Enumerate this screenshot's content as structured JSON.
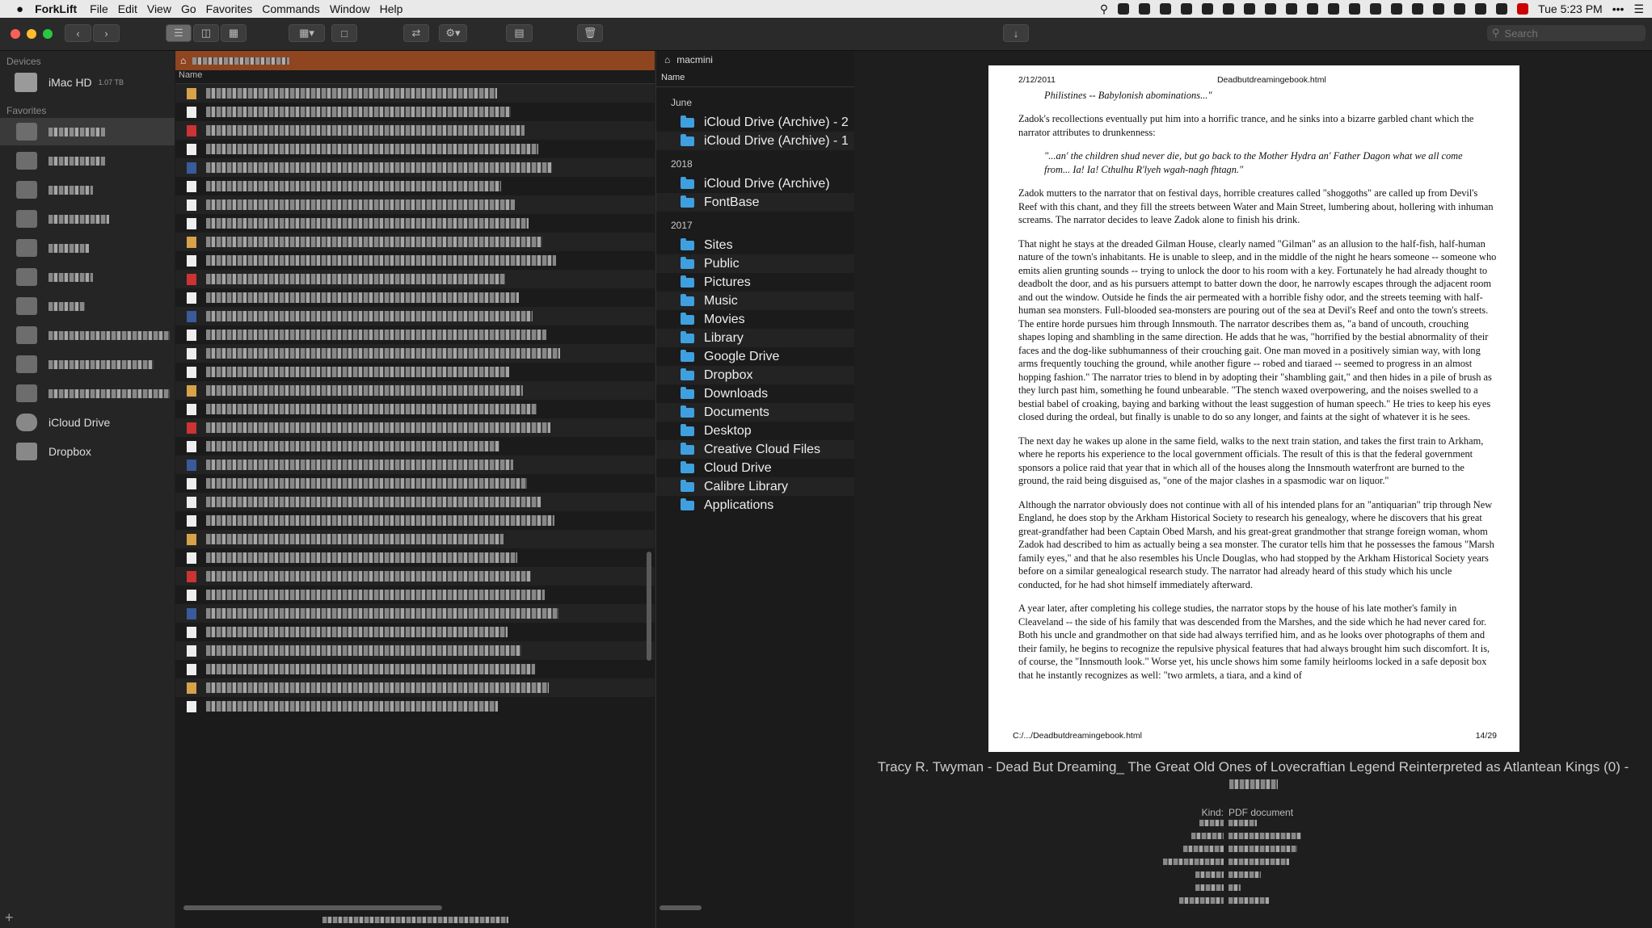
{
  "menubar": {
    "apple": "",
    "app_name": "ForkLift",
    "items": [
      "File",
      "Edit",
      "View",
      "Go",
      "Favorites",
      "Commands",
      "Window",
      "Help"
    ],
    "clock": "Tue 5:23 PM"
  },
  "toolbar": {
    "back_icon": "chevron-left-icon",
    "forward_icon": "chevron-right-icon",
    "search_placeholder": "Search"
  },
  "sidebar": {
    "devices_header": "Devices",
    "device_name": "iMac HD",
    "device_size": "1.07 TB",
    "favorites_header": "Favorites",
    "icloud_label": "iCloud Drive",
    "dropbox_label": "Dropbox"
  },
  "pane1": {
    "col_name": "Name",
    "row_count": 34
  },
  "pane2": {
    "location": "macmini",
    "col_name": "Name",
    "groups": [
      {
        "label": "June",
        "items": [
          "iCloud Drive (Archive) - 2",
          "iCloud Drive (Archive) - 1"
        ]
      },
      {
        "label": "2018",
        "items": [
          "iCloud Drive (Archive)",
          "FontBase"
        ]
      },
      {
        "label": "2017",
        "items": [
          "Sites",
          "Public",
          "Pictures",
          "Music",
          "Movies",
          "Library",
          "Google Drive",
          "Dropbox",
          "Downloads",
          "Documents",
          "Desktop",
          "Creative Cloud Files",
          "Cloud Drive",
          "Calibre Library",
          "Applications"
        ]
      }
    ]
  },
  "preview": {
    "page_date": "2/12/2011",
    "page_file": "Deadbutdreamingebook.html",
    "line0": "Philistines -- Babylonish abominations...\"",
    "p1": "Zadok's recollections eventually put him into a horrific trance, and he sinks into a bizarre garbled chant which the narrator attributes to drunkenness:",
    "q1": "\"...an' the children shud never die, but go back to the Mother Hydra an' Father Dagon what we all come from... Ia! Ia! Cthulhu R'lyeh wgah-nagh fhtagn.\"",
    "p2": "Zadok mutters to the narrator that on festival days, horrible creatures called \"shoggoths\" are called up from Devil's Reef with this chant, and they fill the streets between Water and Main Street, lumbering about, hollering with inhuman screams. The narrator decides to leave Zadok alone to finish his drink.",
    "p3": "That night he stays at the dreaded Gilman House, clearly named \"Gilman\" as an allusion to the half-fish, half-human nature of the town's inhabitants. He is unable to sleep, and in the middle of the night he hears someone -- someone who emits alien grunting sounds -- trying to unlock the door to his room with a key. Fortunately he had already thought to deadbolt the door, and as his pursuers attempt to batter down the door, he narrowly escapes through the adjacent room and out the window. Outside he finds the air permeated with a horrible fishy odor, and the streets teeming with half-human sea monsters. Full-blooded sea-monsters are pouring out of the sea at Devil's Reef and onto the town's streets. The entire horde pursues him through Innsmouth. The narrator describes them as, \"a band of uncouth, crouching shapes loping and shambling in the same direction. He adds that he was, \"horrified by the bestial abnormality of their faces and the dog-like subhumanness of their crouching gait. One man moved in a positively simian way, with long arms frequently touching the ground, while another figure -- robed and tiaraed -- seemed to progress in an almost hopping fashion.\" The narrator tries to blend in by adopting their \"shambling gait,\" and then hides in a pile of brush as they lurch past him, something he found unbearable. \"The stench waxed overpowering, and the noises swelled to a bestial babel of croaking, baying and barking without the least suggestion of human speech.\" He tries to keep his eyes closed during the ordeal, but finally is unable to do so any longer, and faints at the sight of whatever it is he sees.",
    "p4": "The next day he wakes up alone in the same field, walks to the next train station, and takes the first train to Arkham, where he reports his experience to the local government officials. The result of this is that the federal government sponsors a police raid that year that in which all of the houses along the Innsmouth waterfront are burned to the ground, the raid being disguised as, \"one of the major clashes in a spasmodic war on liquor.\"",
    "p5": "Although the narrator obviously does not continue with all of his intended plans for an \"antiquarian\" trip through New England, he does stop by the Arkham Historical Society to research his genealogy, where he discovers that his great great-grandfather had been Captain Obed Marsh, and his great-great grandmother that strange foreign woman, whom Zadok had described to him as actually being a sea monster. The curator tells him that he possesses the famous \"Marsh family eyes,\" and that he also resembles his Uncle Douglas, who had stopped by the Arkham Historical Society years before on a similar genealogical research study. The narrator had already heard of this study which his uncle conducted, for he had shot himself immediately afterward.",
    "p6": "A year later, after completing his college studies, the narrator stops by the house of his late mother's family in Cleaveland -- the side of his family that was descended from the Marshes, and the side which he had never cared for. Both his uncle and grandmother on that side had always terrified him, and as he looks over photographs of them and their family, he begins to recognize the repulsive physical features that had always brought him such discomfort. It is, of course, the \"Innsmouth look.\" Worse yet, his uncle shows him some family heirlooms locked in a safe deposit box that he instantly recognizes as well: \"two armlets, a tiara, and a kind of",
    "footer_path": "C:/.../Deadbutdreamingebook.html",
    "footer_page": "14/29",
    "title": "Tracy R. Twyman - Dead But Dreaming_ The Great Old Ones of Lovecraftian Legend Reinterpreted as Atlantean Kings (0) - ",
    "kind_label": "Kind:",
    "kind_value": "PDF document"
  }
}
